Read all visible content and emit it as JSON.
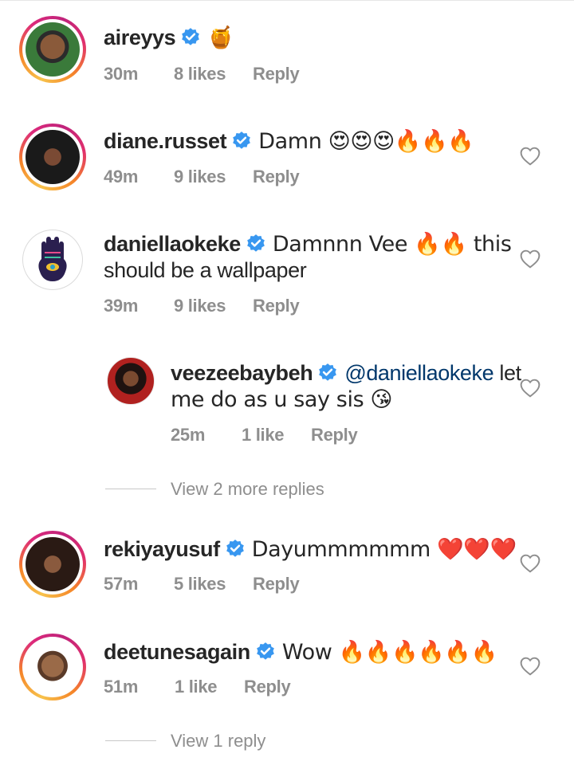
{
  "comments": [
    {
      "username": "aireyys",
      "text": "🍯",
      "time": "30m",
      "likes": "8 likes",
      "reply": "Reply"
    },
    {
      "username": "diane.russet",
      "text": "Damn 😍😍😍🔥🔥🔥",
      "time": "49m",
      "likes": "9 likes",
      "reply": "Reply"
    },
    {
      "username": "daniellaokeke",
      "text_line1": "Damnnn Vee 🔥🔥 this",
      "text_line2": "should be a wallpaper",
      "time": "39m",
      "likes": "9 likes",
      "reply": "Reply"
    },
    {
      "username": "veezeebaybeh",
      "mention": "@daniellaokeke",
      "text_line1_after": " let",
      "text_line2": "me do as u say sis 😘",
      "time": "25m",
      "likes": "1 like",
      "reply": "Reply"
    },
    {
      "username": "rekiyayusuf",
      "text": "Dayummmmmm ❤️❤️❤️",
      "time": "57m",
      "likes": "5 likes",
      "reply": "Reply"
    },
    {
      "username": "deetunesagain",
      "text": "Wow 🔥🔥🔥🔥🔥🔥",
      "time": "51m",
      "likes": "1 like",
      "reply": "Reply"
    }
  ],
  "view_more_replies": "View 2 more replies",
  "view_one_reply": "View 1 reply",
  "colors": {
    "verified": "#3897f0",
    "meta": "#8e8e8e",
    "mention": "#00376b"
  },
  "icons": {
    "verified": "verified-badge-icon",
    "like": "heart-outline-icon"
  }
}
